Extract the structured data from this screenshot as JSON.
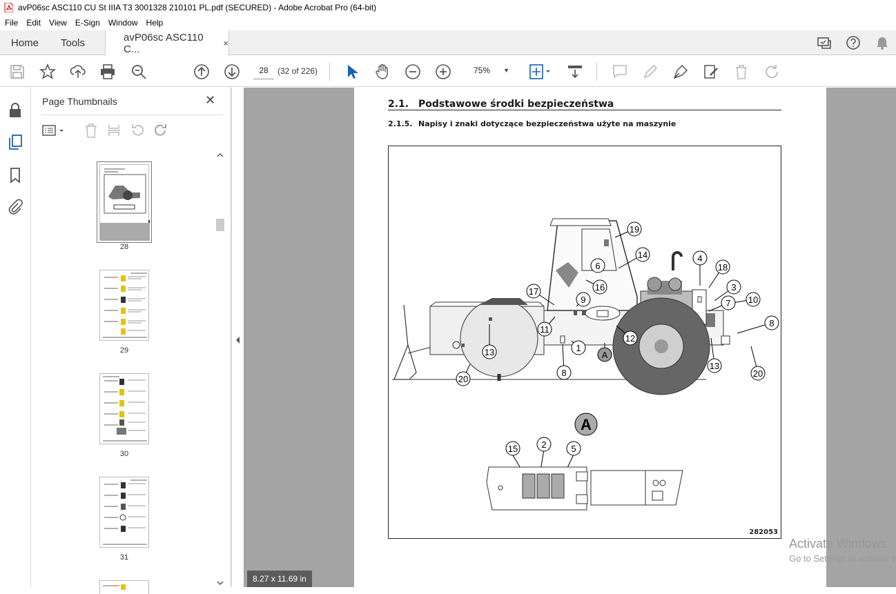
{
  "window": {
    "title": "avP06sc ASC110 CU St IIIA T3 3001328 210101 PL.pdf (SECURED) - Adobe Acrobat Pro (64-bit)"
  },
  "menu": [
    "File",
    "Edit",
    "View",
    "E-Sign",
    "Window",
    "Help"
  ],
  "tabs": {
    "home": "Home",
    "tools": "Tools",
    "document": "avP06sc ASC110 C...",
    "close": "×"
  },
  "toolbar": {
    "page_number": "28",
    "page_count": "(32 of 226)",
    "zoom": "75%"
  },
  "thumbnails": {
    "title": "Page Thumbnails",
    "close": "✕",
    "pages": [
      {
        "label": "28"
      },
      {
        "label": "29"
      },
      {
        "label": "30"
      },
      {
        "label": "31"
      }
    ]
  },
  "document": {
    "section_number": "2.1.",
    "section_title": "Podstawowe środki bezpieczeństwa",
    "subsection_number": "2.1.5.",
    "subsection_title": "Napisy i znaki dotyczące bezpieczeństwa użyte na maszynie",
    "figure_id": "282053",
    "detail_label": "A",
    "callouts": [
      "19",
      "14",
      "4",
      "18",
      "6",
      "16",
      "3",
      "17",
      "9",
      "7",
      "10",
      "8",
      "11",
      "12",
      "1",
      "13",
      "A",
      "13",
      "20",
      "8",
      "20",
      "15",
      "2",
      "5"
    ]
  },
  "status": {
    "page_size": "8.27 x 11.69 in"
  },
  "watermark": {
    "line1": "Activate Windows",
    "line2": "Go to Settings to activate Windows."
  }
}
